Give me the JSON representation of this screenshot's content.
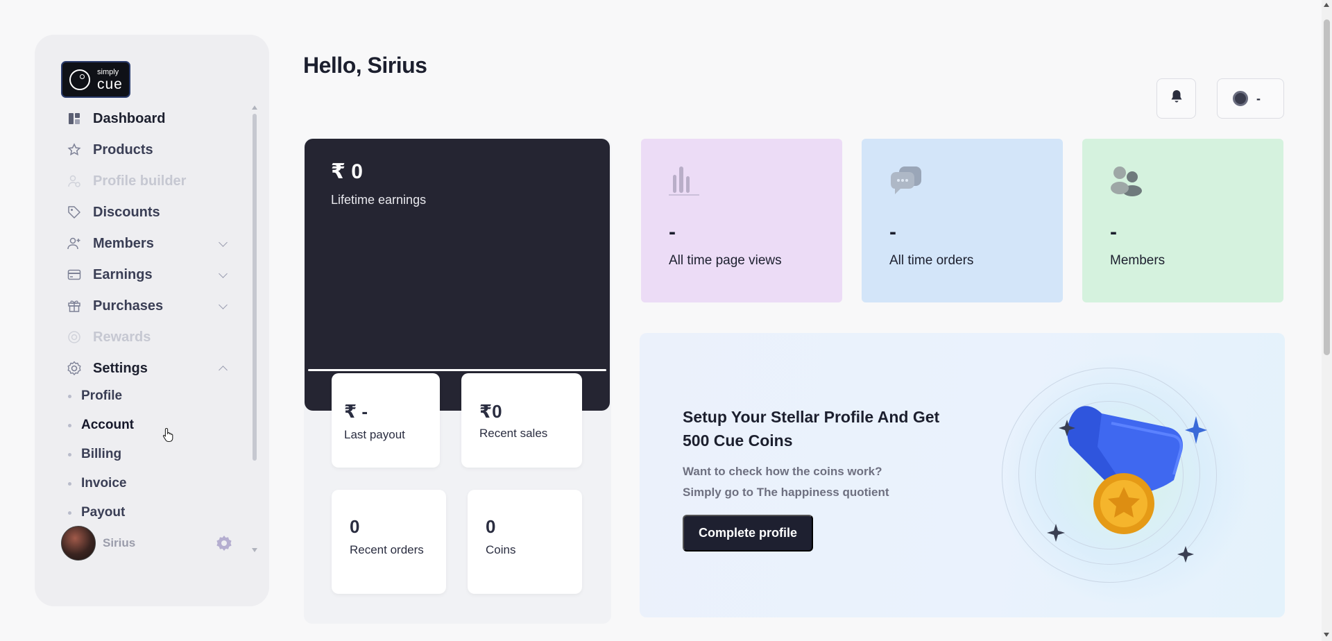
{
  "brand": {
    "logo_top": "simply",
    "logo_main": "cue"
  },
  "sidebar": {
    "items": [
      {
        "label": "Dashboard",
        "icon": "dashboard-icon",
        "state": "active"
      },
      {
        "label": "Products",
        "icon": "star-icon",
        "state": "normal"
      },
      {
        "label": "Profile builder",
        "icon": "profile-builder-icon",
        "state": "disabled"
      },
      {
        "label": "Discounts",
        "icon": "tag-icon",
        "state": "normal"
      },
      {
        "label": "Members",
        "icon": "members-icon",
        "state": "collapsed"
      },
      {
        "label": "Earnings",
        "icon": "card-icon",
        "state": "collapsed"
      },
      {
        "label": "Purchases",
        "icon": "gift-icon",
        "state": "collapsed"
      },
      {
        "label": "Rewards",
        "icon": "rewards-icon",
        "state": "disabled"
      },
      {
        "label": "Settings",
        "icon": "gear-icon",
        "state": "expanded"
      }
    ],
    "settings_children": [
      "Profile",
      "Account",
      "Billing",
      "Invoice",
      "Payout"
    ],
    "user": {
      "name": "Sirius"
    }
  },
  "header": {
    "greeting": "Hello, Sirius",
    "coin_value": "-"
  },
  "earnings": {
    "amount": "₹ 0",
    "label": "Lifetime earnings",
    "last_payout_value": "₹ -",
    "last_payout_label": "Last payout",
    "recent_sales_value": "₹0",
    "recent_sales_label": "Recent sales",
    "recent_orders_value": "0",
    "recent_orders_label": "Recent orders",
    "coins_value": "0",
    "coins_label": "Coins"
  },
  "stats": [
    {
      "value": "-",
      "label": "All time page views",
      "bg": "#ecdcf6",
      "icon": "bar-chart-icon"
    },
    {
      "value": "-",
      "label": "All time orders",
      "bg": "#d3e5f9",
      "icon": "chat-bubbles-icon"
    },
    {
      "value": "-",
      "label": "Members",
      "bg": "#d5f2de",
      "icon": "users-icon"
    }
  ],
  "promo": {
    "title": "Setup Your Stellar Profile And Get 500 Cue Coins",
    "line1": "Want to check how the coins work?",
    "line2": "Simply go to The happiness quotient",
    "button": "Complete profile"
  },
  "colors": {
    "dark_card": "#252532",
    "accent_medal": "#3359e0",
    "gold": "#f0a81c"
  }
}
